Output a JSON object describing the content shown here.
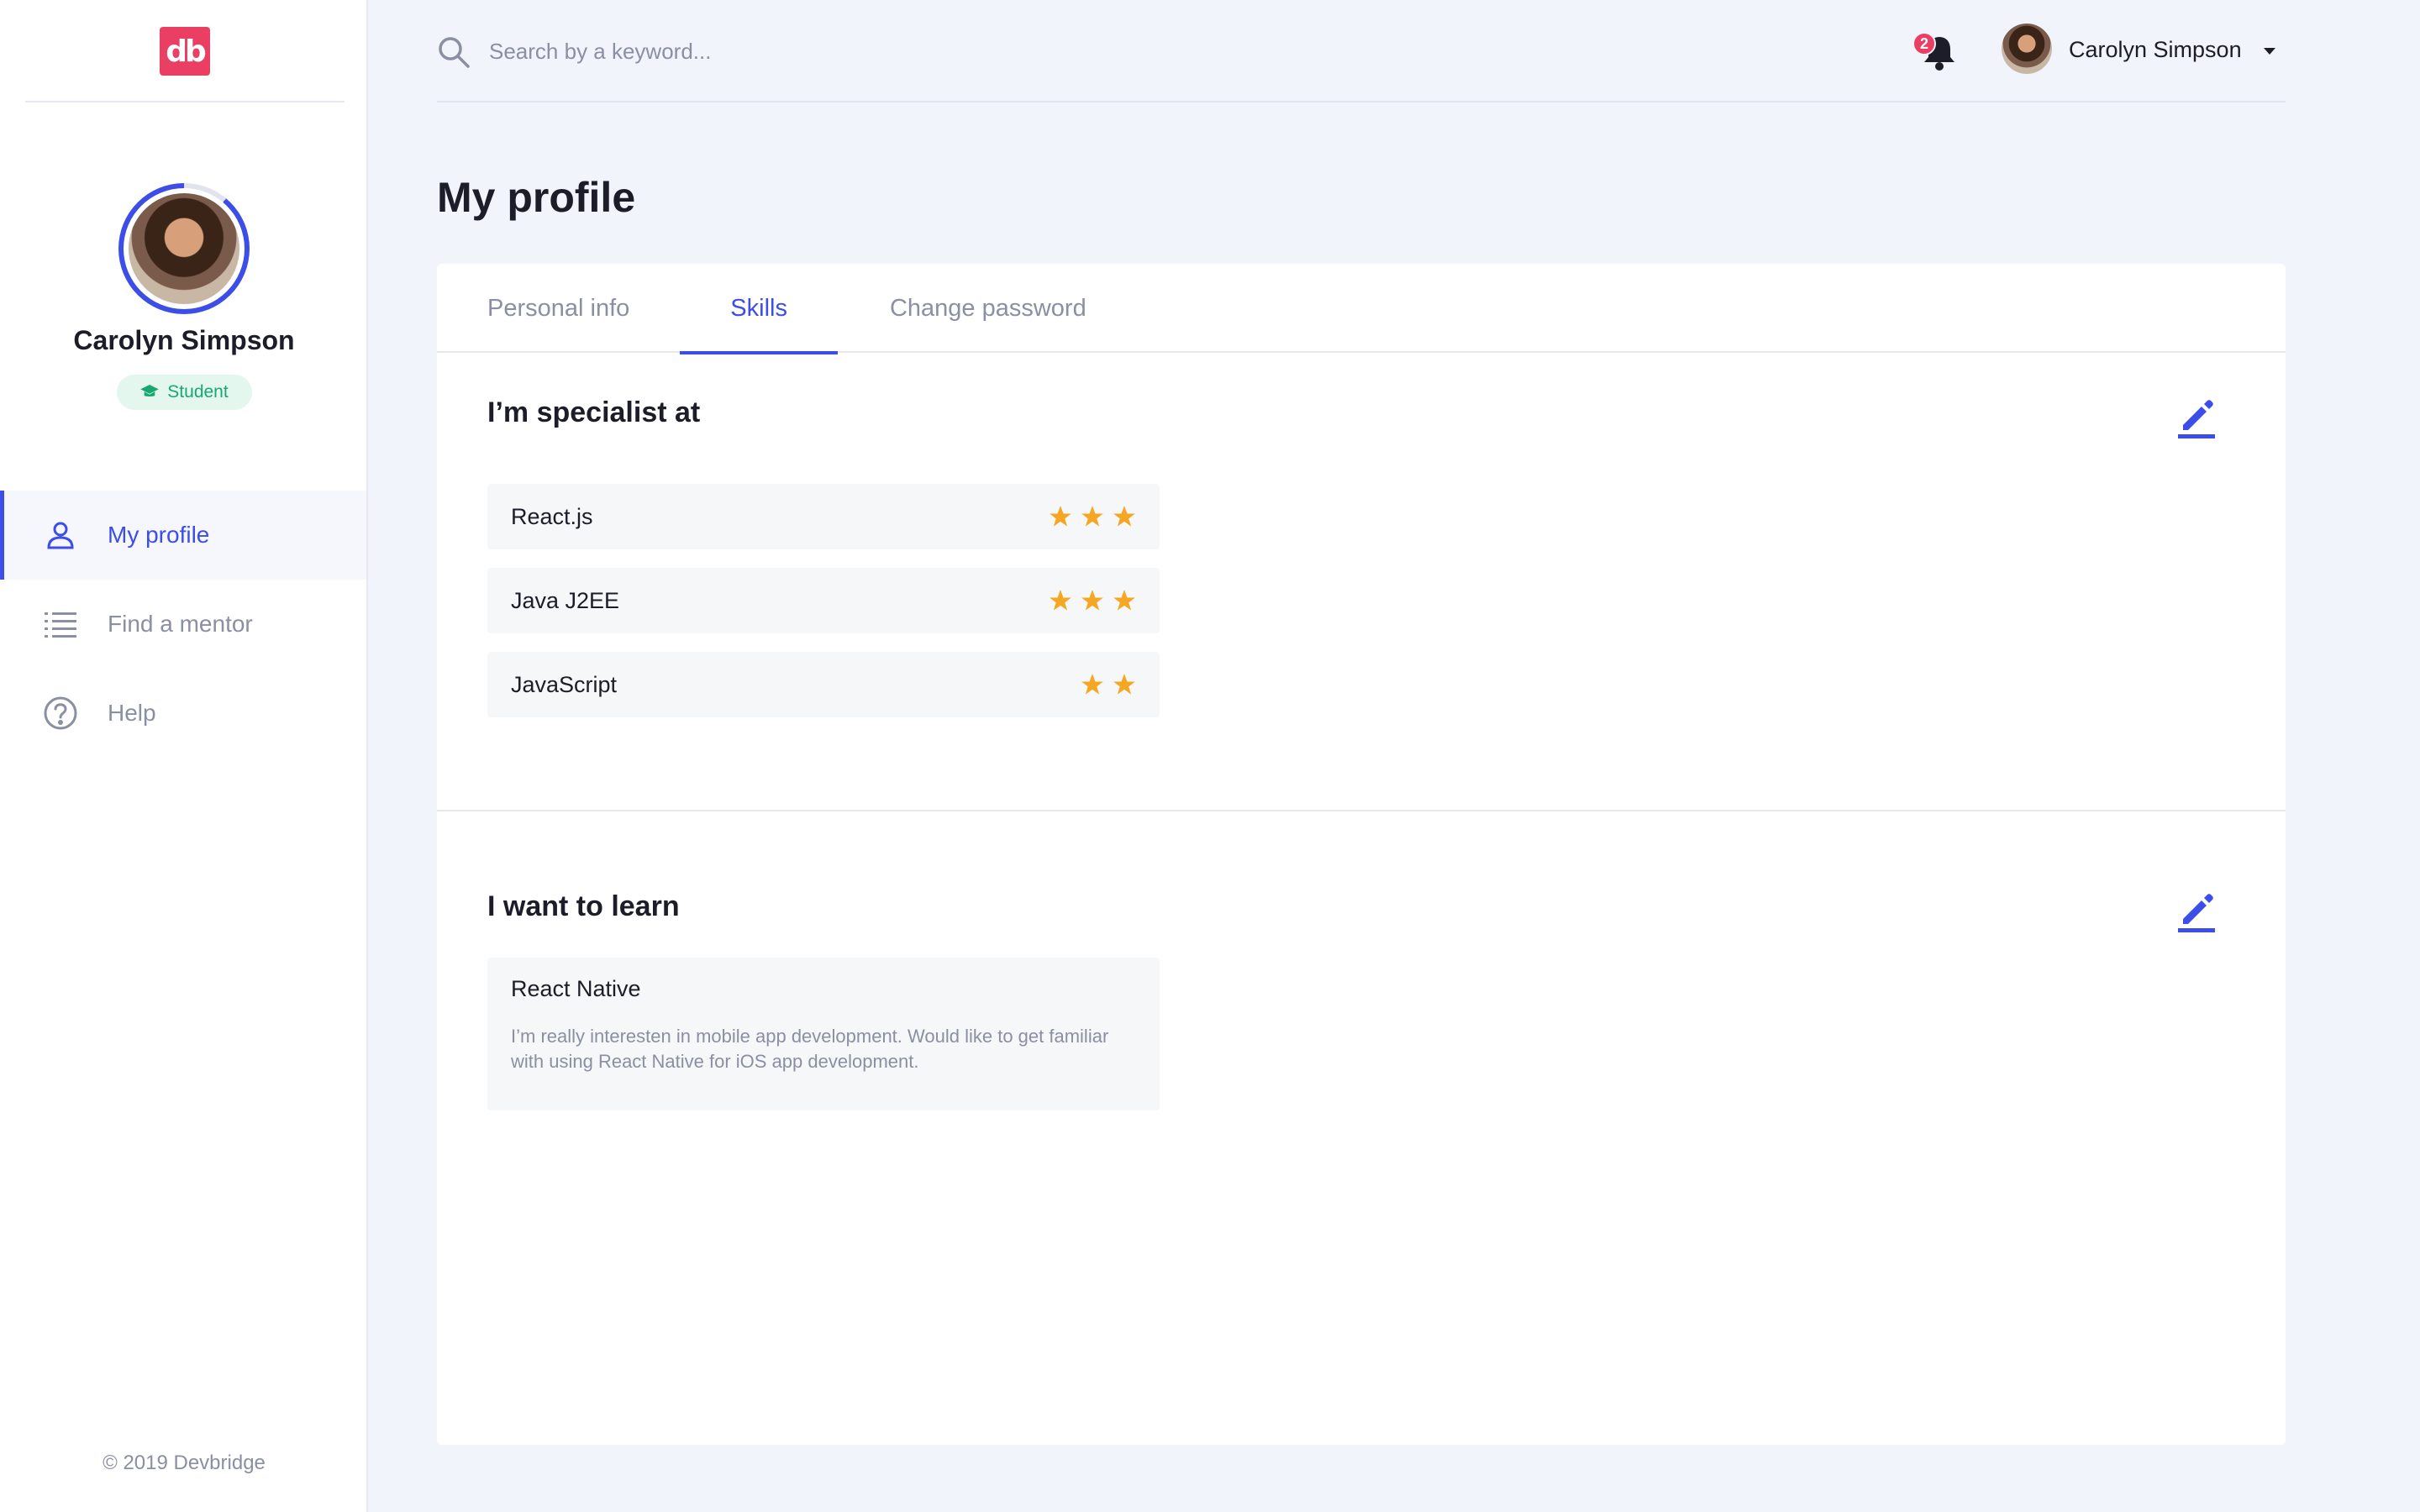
{
  "app": {
    "logo_text": "db",
    "footer": "© 2019 Devbridge"
  },
  "profile": {
    "name": "Carolyn Simpson",
    "role": "Student",
    "profile_completion": 0.9
  },
  "sidebar": {
    "items": [
      {
        "label": "My profile",
        "icon": "user-icon",
        "active": true
      },
      {
        "label": "Find a mentor",
        "icon": "list-icon",
        "active": false
      },
      {
        "label": "Help",
        "icon": "help-icon",
        "active": false
      }
    ]
  },
  "topbar": {
    "search_placeholder": "Search by a keyword...",
    "notification_count": "2",
    "user_name": "Carolyn Simpson"
  },
  "page": {
    "title": "My profile"
  },
  "tabs": [
    {
      "label": "Personal info",
      "active": false
    },
    {
      "label": "Skills",
      "active": true
    },
    {
      "label": "Change password",
      "active": false
    }
  ],
  "specialist": {
    "title": "I’m specialist at",
    "skills": [
      {
        "name": "React.js",
        "rating": 3
      },
      {
        "name": "Java J2EE",
        "rating": 3
      },
      {
        "name": "JavaScript",
        "rating": 2
      }
    ]
  },
  "learn": {
    "title": "I want to learn",
    "items": [
      {
        "name": "React Native",
        "description": "I’m really interesten in mobile app development. Would like to get familiar with using React Native for iOS app development."
      }
    ]
  },
  "colors": {
    "accent": "#3d4de8",
    "brand": "#ea3e62",
    "star": "#f5a623",
    "badge_green": "#19a771",
    "muted_text": "#8a8fa3",
    "background": "#f1f4fb"
  }
}
